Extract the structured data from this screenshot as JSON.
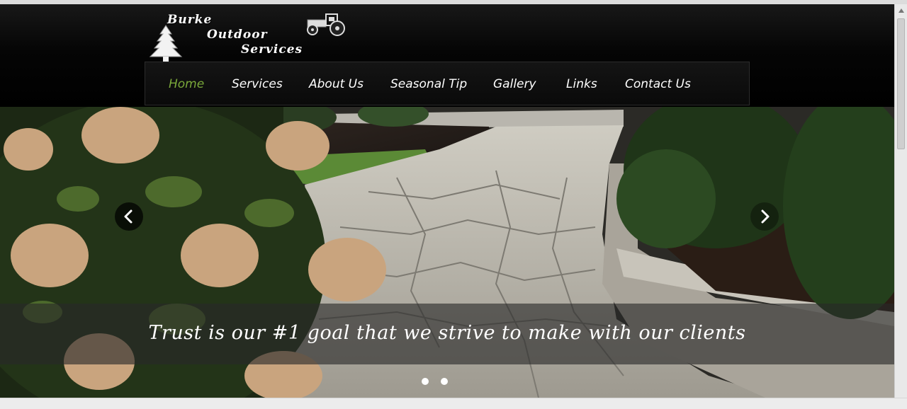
{
  "logo": {
    "line1": "Burke",
    "line2": "Outdoor",
    "line3": "Services",
    "tree_icon": "pine-tree-icon",
    "tractor_icon": "tractor-icon"
  },
  "nav": {
    "items": [
      {
        "label": "Home",
        "active": true
      },
      {
        "label": "Services",
        "active": false
      },
      {
        "label": "About Us",
        "active": false
      },
      {
        "label": "Seasonal Tip",
        "active": false
      },
      {
        "label": "Gallery",
        "active": false
      },
      {
        "label": "Links",
        "active": false
      },
      {
        "label": "Contact Us",
        "active": false
      }
    ],
    "active_color": "#7aa83a",
    "text_color": "#ffffff"
  },
  "carousel": {
    "caption": "Trust is our #1 goal that we strive to make with our clients",
    "prev_icon": "chevron-left-icon",
    "next_icon": "chevron-right-icon",
    "slides_count": 2,
    "active_slide": 1
  },
  "colors": {
    "header_bg": "#000000",
    "accent": "#7aa83a"
  }
}
